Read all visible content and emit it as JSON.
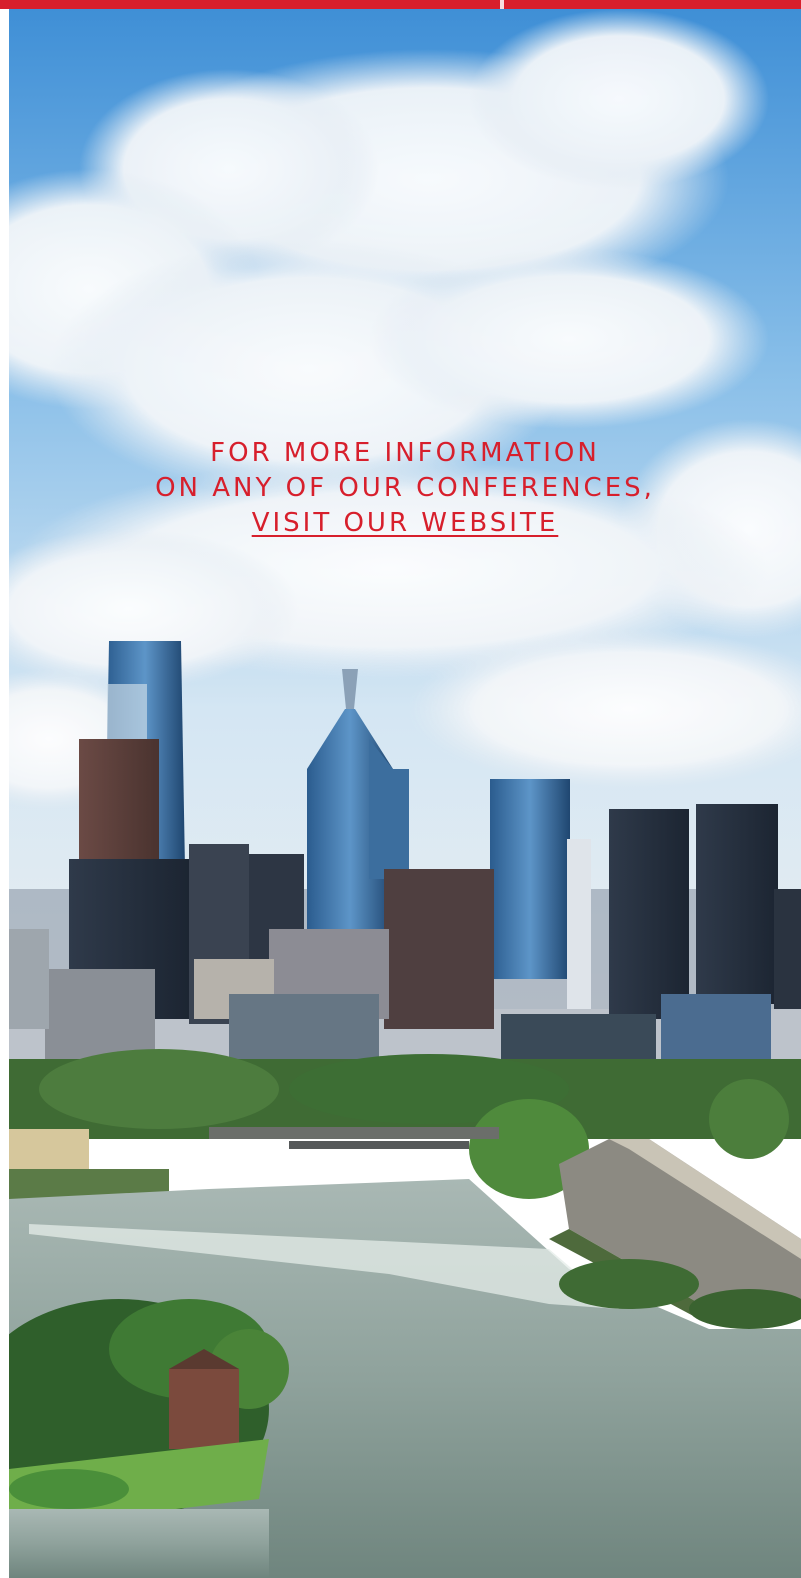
{
  "cta": {
    "line1": "FOR MORE INFORMATION",
    "line2": "ON ANY OF OUR CONFERENCES,",
    "link_text": "VISIT OUR WEBSITE"
  },
  "colors": {
    "accent": "#d71f2c",
    "background": "#ffffff"
  },
  "hero_image": {
    "icon": "philadelphia-skyline-photo"
  }
}
